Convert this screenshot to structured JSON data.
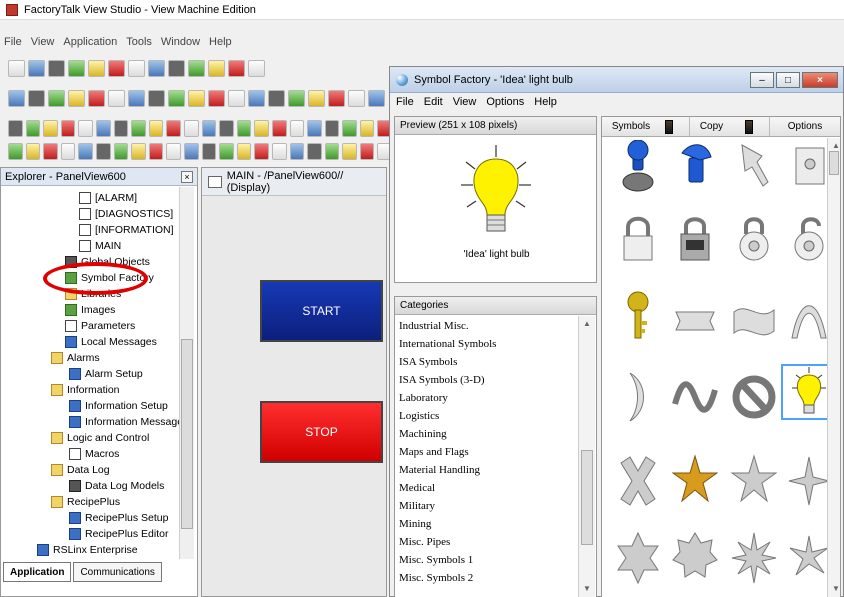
{
  "window": {
    "title": "FactoryTalk View Studio - View Machine Edition"
  },
  "menu": {
    "items": [
      "File",
      "View",
      "Application",
      "Tools",
      "Window",
      "Help"
    ]
  },
  "toolbars": {
    "row1": 13,
    "row2": 19,
    "row3": 22,
    "row4": 22
  },
  "explorer": {
    "title": "Explorer - PanelView600",
    "items": [
      "[ALARM]",
      "[DIAGNOSTICS]",
      "[INFORMATION]",
      "MAIN",
      "Global Objects",
      "Symbol Factory",
      "Libraries",
      "Images",
      "Parameters",
      "Local Messages",
      "Alarms",
      "Alarm Setup",
      "Information",
      "Information Setup",
      "Information Messages",
      "Logic and Control",
      "Macros",
      "Data Log",
      "Data Log Models",
      "RecipePlus",
      "RecipePlus Setup",
      "RecipePlus Editor",
      "RSLinx Enterprise"
    ],
    "tabs": [
      "Application",
      "Communications"
    ]
  },
  "display": {
    "title": "MAIN - /PanelView600// (Display)",
    "buttons": {
      "start": "START",
      "stop": "STOP"
    }
  },
  "symbol_factory": {
    "title": "Symbol Factory - 'Idea' light bulb",
    "menu": [
      "File",
      "Edit",
      "View",
      "Options",
      "Help"
    ],
    "preview_label": "Preview (251 x 108 pixels)",
    "preview_caption": "'Idea' light bulb",
    "categories_label": "Categories",
    "categories": [
      "Industrial Misc.",
      "International Symbols",
      "ISA Symbols",
      "ISA Symbols (3-D)",
      "Laboratory",
      "Logistics",
      "Machining",
      "Maps and Flags",
      "Material Handling",
      "Medical",
      "Military",
      "Mining",
      "Misc. Pipes",
      "Misc. Symbols 1",
      "Misc. Symbols 2"
    ],
    "tabs": [
      "Symbols",
      "Copy",
      "Options"
    ]
  }
}
